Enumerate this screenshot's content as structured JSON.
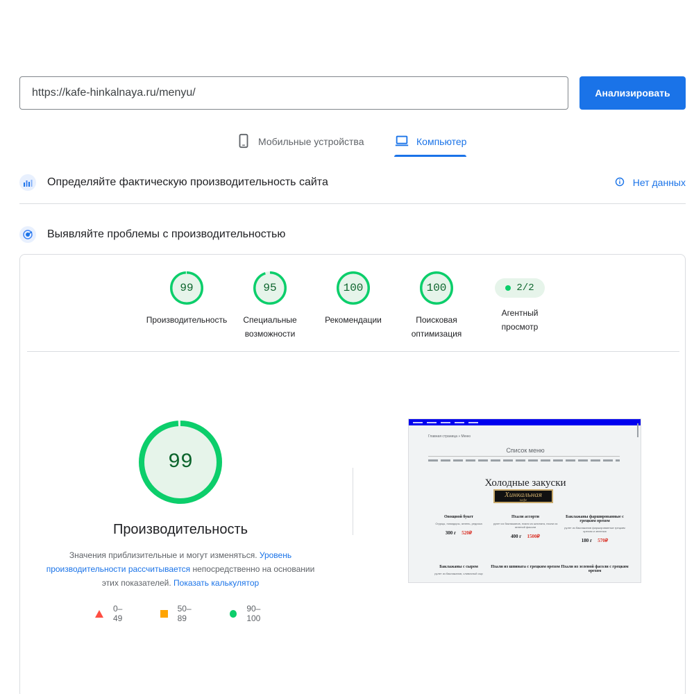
{
  "search": {
    "url_value": "https://kafe-hinkalnaya.ru/menyu/",
    "analyze_label": "Анализировать"
  },
  "tabs": {
    "mobile_label": "Мобильные устройства",
    "desktop_label": "Компьютер",
    "active": "desktop"
  },
  "field_data": {
    "title": "Определяйте фактическую производительность сайта",
    "no_data_label": "Нет данных"
  },
  "lab_data": {
    "title": "Выявляйте проблемы с производительностью"
  },
  "categories": [
    {
      "score": "99",
      "label_line1": "Производительность",
      "label_line2": "",
      "fraction": 0.99
    },
    {
      "score": "95",
      "label_line1": "Специальные",
      "label_line2": "возможности",
      "fraction": 0.95
    },
    {
      "score": "100",
      "label_line1": "Рекомендации",
      "label_line2": "",
      "fraction": 1.0
    },
    {
      "score": "100",
      "label_line1": "Поисковая",
      "label_line2": "оптимизация",
      "fraction": 1.0
    },
    {
      "score": "2/2",
      "label_line1": "Агентный",
      "label_line2": "просмотр"
    }
  ],
  "performance": {
    "score": "99",
    "fraction": 0.99,
    "title": "Производительность",
    "note_text1": "Значения приблизительные и могут изменяться. ",
    "note_link1": "Уровень производительности рассчитывается",
    "note_text2": " непосредственно на основании этих показателей. ",
    "note_link2": "Показать калькулятор"
  },
  "legend": {
    "fail": "0–49",
    "average": "50–89",
    "pass": "90–100"
  },
  "screenshot": {
    "breadcrumb": "Главная страница   »   Меню",
    "menu_title": "Список меню",
    "heading": "Холодные закуски",
    "logo_text": "Хинкальная",
    "logo_sub": "кафе",
    "items": [
      {
        "title": "Овощной букет",
        "desc": "Огурцы, помидоры, зелень, редиска",
        "weight": "300 г",
        "price": "520₽"
      },
      {
        "title": "Пхали ассорти",
        "desc": "рулет из баклажанов, пхали из шпината, пхали из зеленой фасоли",
        "weight": "400 г",
        "price": "1500₽"
      },
      {
        "title": "Баклажаны фаршированные с грецким орехом",
        "desc": "рулет из баклажанов фаршированные грецким орехом и зеленью",
        "weight": "180 г",
        "price": "570₽"
      },
      {
        "title": "Баклажаны с сыром",
        "desc": "рулет из баклажанов, сливочный сыр"
      },
      {
        "title": "Пхали из шпината с грецким орехом",
        "desc": ""
      },
      {
        "title": "Пхали из зеленой фасоли с грецким орехом",
        "desc": ""
      }
    ]
  },
  "colors": {
    "primary": "#1a73e8",
    "pass": "#0cce6b",
    "pass_text": "#0d652d",
    "pass_bg": "#e6f4ea",
    "average": "#ffa400",
    "fail": "#ff4e42"
  }
}
